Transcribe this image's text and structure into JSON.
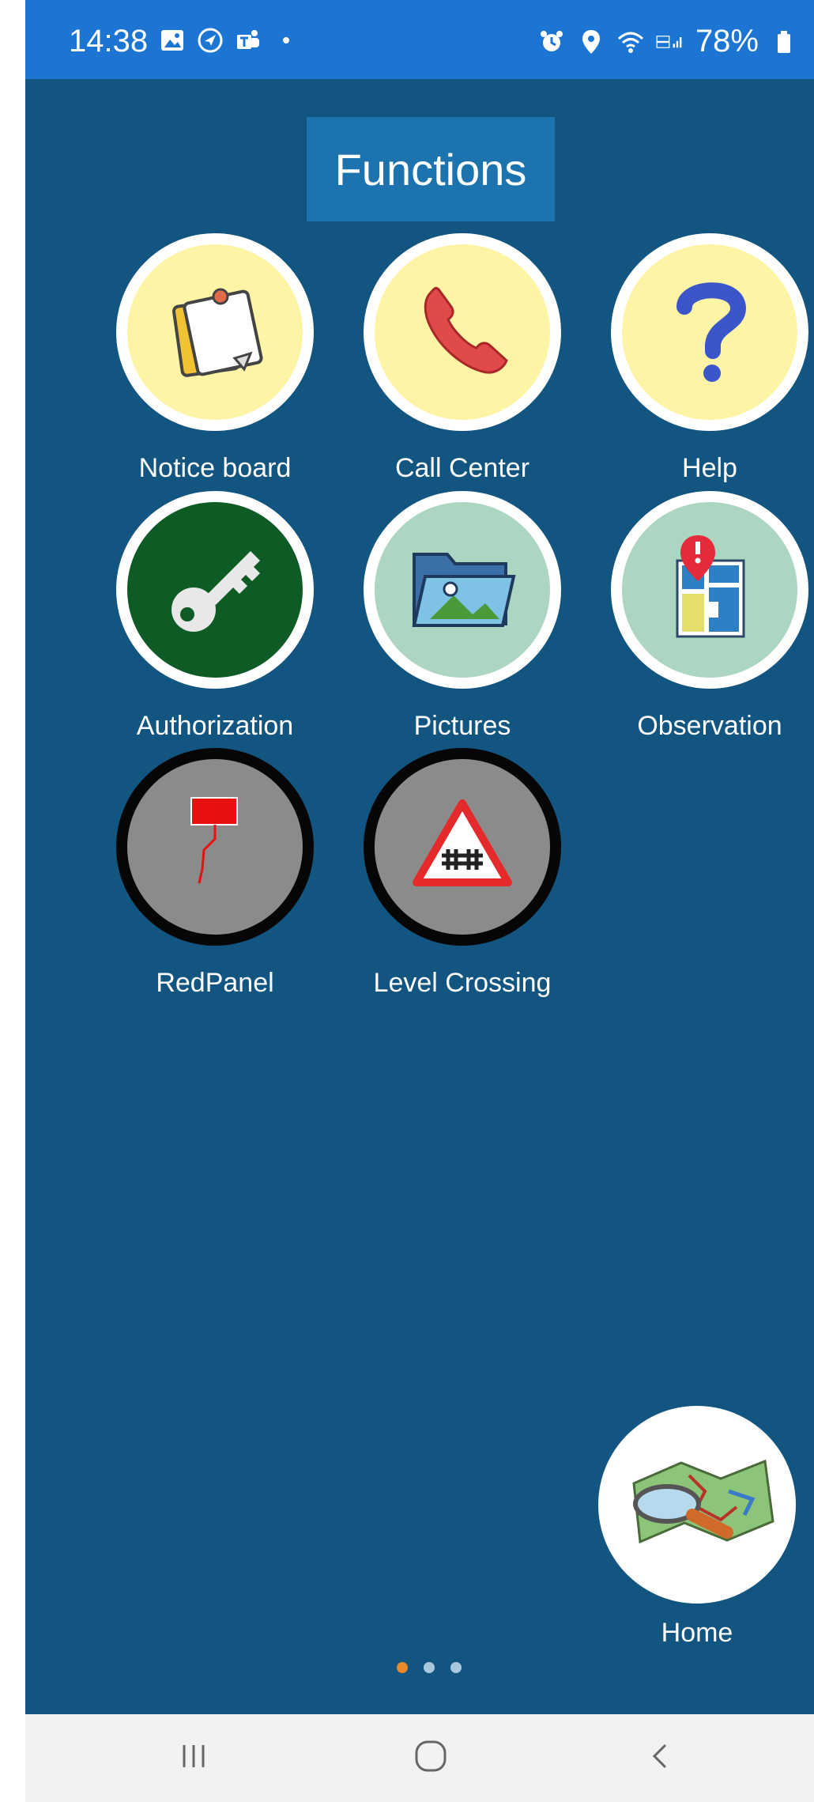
{
  "status_bar": {
    "time": "14:38",
    "battery": "78%"
  },
  "page_title": "Functions",
  "functions": [
    {
      "label": "Notice board",
      "icon": "notice-board-icon"
    },
    {
      "label": "Call Center",
      "icon": "phone-icon"
    },
    {
      "label": "Help",
      "icon": "question-mark-icon"
    },
    {
      "label": "Authorization",
      "icon": "key-icon"
    },
    {
      "label": "Pictures",
      "icon": "picture-folder-icon"
    },
    {
      "label": "Observation",
      "icon": "map-pin-icon"
    },
    {
      "label": "RedPanel",
      "icon": "red-flag-icon"
    },
    {
      "label": "Level Crossing",
      "icon": "level-crossing-sign-icon"
    }
  ],
  "home": {
    "label": "Home",
    "icon": "map-magnifier-icon"
  },
  "pager": {
    "pages": 3,
    "active": 1
  },
  "colors": {
    "background": "#125580",
    "status_bar": "#1c75d2",
    "title_box": "#1c73ad",
    "yellow_circle": "#fdf4a5",
    "green_circle": "#0e5b25",
    "mint_circle": "#acd6c2",
    "gray_circle": "#8b8b8b",
    "active_dot": "#e98a2a"
  }
}
